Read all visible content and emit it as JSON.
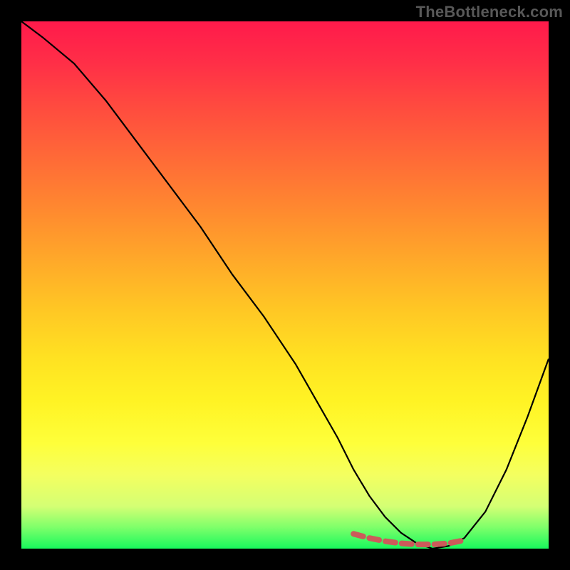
{
  "watermark": "TheBottleneck.com",
  "chart_data": {
    "type": "line",
    "title": "",
    "xlabel": "",
    "ylabel": "",
    "xlim": [
      0,
      100
    ],
    "ylim": [
      0,
      100
    ],
    "series": [
      {
        "name": "curve",
        "color": "#000000",
        "x": [
          0,
          4,
          10,
          16,
          22,
          28,
          34,
          40,
          46,
          52,
          56,
          60,
          63,
          66,
          69,
          72,
          75,
          78,
          81,
          84,
          88,
          92,
          96,
          100
        ],
        "values": [
          100,
          97,
          92,
          85,
          77,
          69,
          61,
          52,
          44,
          35,
          28,
          21,
          15,
          10,
          6,
          3,
          1,
          0,
          0.5,
          2,
          7,
          15,
          25,
          36
        ]
      },
      {
        "name": "optimal-band",
        "color": "#cc5a5a",
        "x": [
          63,
          66,
          69,
          72,
          75,
          78,
          81,
          84
        ],
        "values": [
          2.8,
          2.0,
          1.4,
          1.0,
          0.8,
          0.8,
          1.0,
          1.6
        ]
      }
    ],
    "gradient_stops": [
      {
        "pos": 0,
        "color": "#ff1a4b"
      },
      {
        "pos": 50,
        "color": "#ffc824"
      },
      {
        "pos": 80,
        "color": "#feff3a"
      },
      {
        "pos": 100,
        "color": "#18f85d"
      }
    ]
  }
}
